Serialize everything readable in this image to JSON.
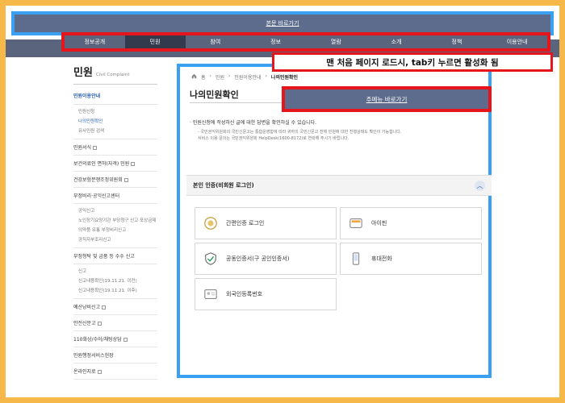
{
  "skip_top_label": "본문 바로가기",
  "gnb": [
    "정보공개",
    "민원",
    "참여",
    "정보",
    "열람",
    "소개",
    "정책",
    "이용안내"
  ],
  "annotation": "맨 처음 페이지 로드시, tab키 누르면 활성화 됨",
  "sidebar": {
    "title": "민원",
    "title_en": "Civil Complaint",
    "section": "민원이용안내",
    "subs": [
      "민원신청",
      "나의민원확인",
      "유사민원 검색"
    ],
    "items": [
      "민원서식",
      "보건의료인 면허(자격) 민원",
      "건강보험분쟁조정위원회",
      "부정비리·공익신고센터"
    ],
    "subs2": [
      "공익신고",
      "노인장기요양기관 부당청구 신고 포상금제",
      "의약품 유통 부정비리신고",
      "공직자부조리신고"
    ],
    "item2": "부정청탁 및 금품 등 수수 신고",
    "subs3": [
      "신고",
      "신고내용확인(19.11.21. 이전)",
      "신고내용확인(19.11.21. 이후)"
    ],
    "items3": [
      "예산낭비신고",
      "안전신문고",
      "110화상/수어/채팅상담",
      "민원행정서비스헌장",
      "온라인지로"
    ]
  },
  "breadcrumb": [
    "홈",
    "민원",
    "민원이용안내",
    "나의민원확인"
  ],
  "page_title": "나의민원확인",
  "skip_menu_label": "주메뉴 바로가기",
  "notice": {
    "lead": "· 민원신청에 작성하신 글에 대한 답변을 확인하실 수 있습니다.",
    "sub1": "- 국민권익위원회의 국민신문고는 통합운영함에 따라 귀하의 국민신문고 전체 민원에 대한 진행상태도 확인이 가능합니다.",
    "sub2": "서비스 이용 문의는 국민권익위원회 HelpDesk(1600-8172)로 연락해 주시기 바랍니다."
  },
  "auth_header": "본인 인증(비회원 로그인)",
  "auth_options": [
    "간편인증 로그인",
    "아이핀",
    "공동인증서(구 공인인증서)",
    "휴대전화",
    "외국인등록번호"
  ],
  "icons": {
    "simple_auth": "medal-icon",
    "ipin": "ipin-card-icon",
    "cert": "shield-check-icon",
    "phone": "phone-icon",
    "foreign": "id-card-icon",
    "chevron": "chevron-up-icon",
    "home": "home-icon"
  },
  "colors": {
    "accent_blue": "#3aa0f2",
    "highlight_red": "#e5151b",
    "nav_bg": "#5a647c",
    "frame_orange": "#f7b84a"
  }
}
